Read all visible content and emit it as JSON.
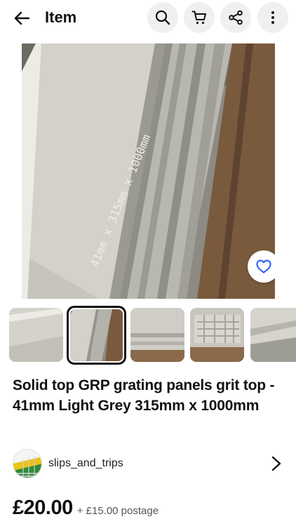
{
  "header": {
    "title": "Item",
    "icons": [
      "back-arrow-icon",
      "search-icon",
      "cart-icon",
      "share-icon",
      "more-vertical-icon"
    ]
  },
  "gallery": {
    "main_image_caption": "41mm x 315mm x 1000mm",
    "wishlist_icon": "heart-outline-icon",
    "thumbnail_count": 5,
    "selected_thumbnail": 2
  },
  "listing": {
    "title": "Solid top GRP grating panels grit top - 41mm Light Grey 315mm x 1000mm",
    "price": "£20.00",
    "postage": "+ £15.00 postage"
  },
  "seller": {
    "name": "slips_and_trips",
    "avatar_icon": "seller-logo-avatar"
  },
  "colors": {
    "icon_button_bg": "#f0f0f0",
    "text": "#111111",
    "secondary_text": "#555555",
    "selected_border": "#111111",
    "heart": "#3665f3"
  }
}
